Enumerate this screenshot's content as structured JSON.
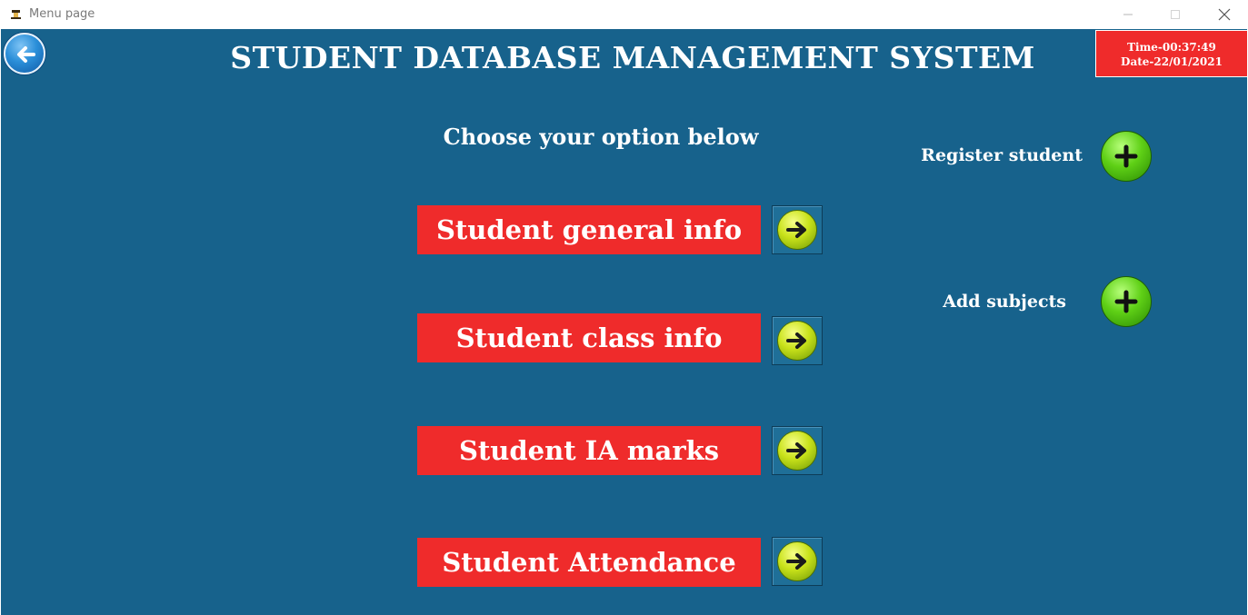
{
  "window": {
    "title": "Menu page",
    "minimize_glyph": "—",
    "maximize_glyph": "☐",
    "close_glyph": "✕"
  },
  "header": {
    "title": "STUDENT DATABASE MANAGEMENT SYSTEM",
    "time": "Time-00:37:49",
    "date": "Date-22/01/2021"
  },
  "subtitle": "Choose your option below",
  "menu": [
    {
      "label": "Student general info"
    },
    {
      "label": "Student class info"
    },
    {
      "label": "Student IA marks"
    },
    {
      "label": "Student Attendance"
    }
  ],
  "side_actions": [
    {
      "label": "Register student"
    },
    {
      "label": "Add subjects"
    }
  ],
  "colors": {
    "background": "#17628c",
    "label_red": "#ef2b2b",
    "title_text": "#ffffff"
  },
  "icons": {
    "back": "back-arrow-icon",
    "go": "right-arrow-icon",
    "add": "plus-icon"
  }
}
